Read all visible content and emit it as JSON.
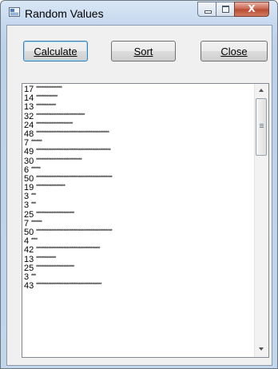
{
  "window": {
    "title": "Random Values",
    "icon": "form-icon"
  },
  "caption_buttons": {
    "minimize_icon": "minimize-icon",
    "maximize_icon": "maximize-icon",
    "close_glyph": "X"
  },
  "toolbar": {
    "calculate_label": "Calculate",
    "sort_label": "Sort",
    "close_label": "Close"
  },
  "list": {
    "items": [
      {
        "value": "17",
        "stars": 17
      },
      {
        "value": "14",
        "stars": 14
      },
      {
        "value": "13",
        "stars": 13
      },
      {
        "value": "32",
        "stars": 32
      },
      {
        "value": "24",
        "stars": 24
      },
      {
        "value": "48",
        "stars": 48
      },
      {
        "value": "7",
        "stars": 7
      },
      {
        "value": "49",
        "stars": 49
      },
      {
        "value": "30",
        "stars": 30
      },
      {
        "value": "6",
        "stars": 6
      },
      {
        "value": "50",
        "stars": 50
      },
      {
        "value": "19",
        "stars": 19
      },
      {
        "value": "3",
        "stars": 3
      },
      {
        "value": "3",
        "stars": 3
      },
      {
        "value": "25",
        "stars": 25
      },
      {
        "value": "7",
        "stars": 7
      },
      {
        "value": "50",
        "stars": 50
      },
      {
        "value": "4",
        "stars": 4
      },
      {
        "value": "42",
        "stars": 42
      },
      {
        "value": "13",
        "stars": 13
      },
      {
        "value": "25",
        "stars": 25
      },
      {
        "value": "3",
        "stars": 3
      },
      {
        "value": "43",
        "stars": 43
      }
    ]
  }
}
